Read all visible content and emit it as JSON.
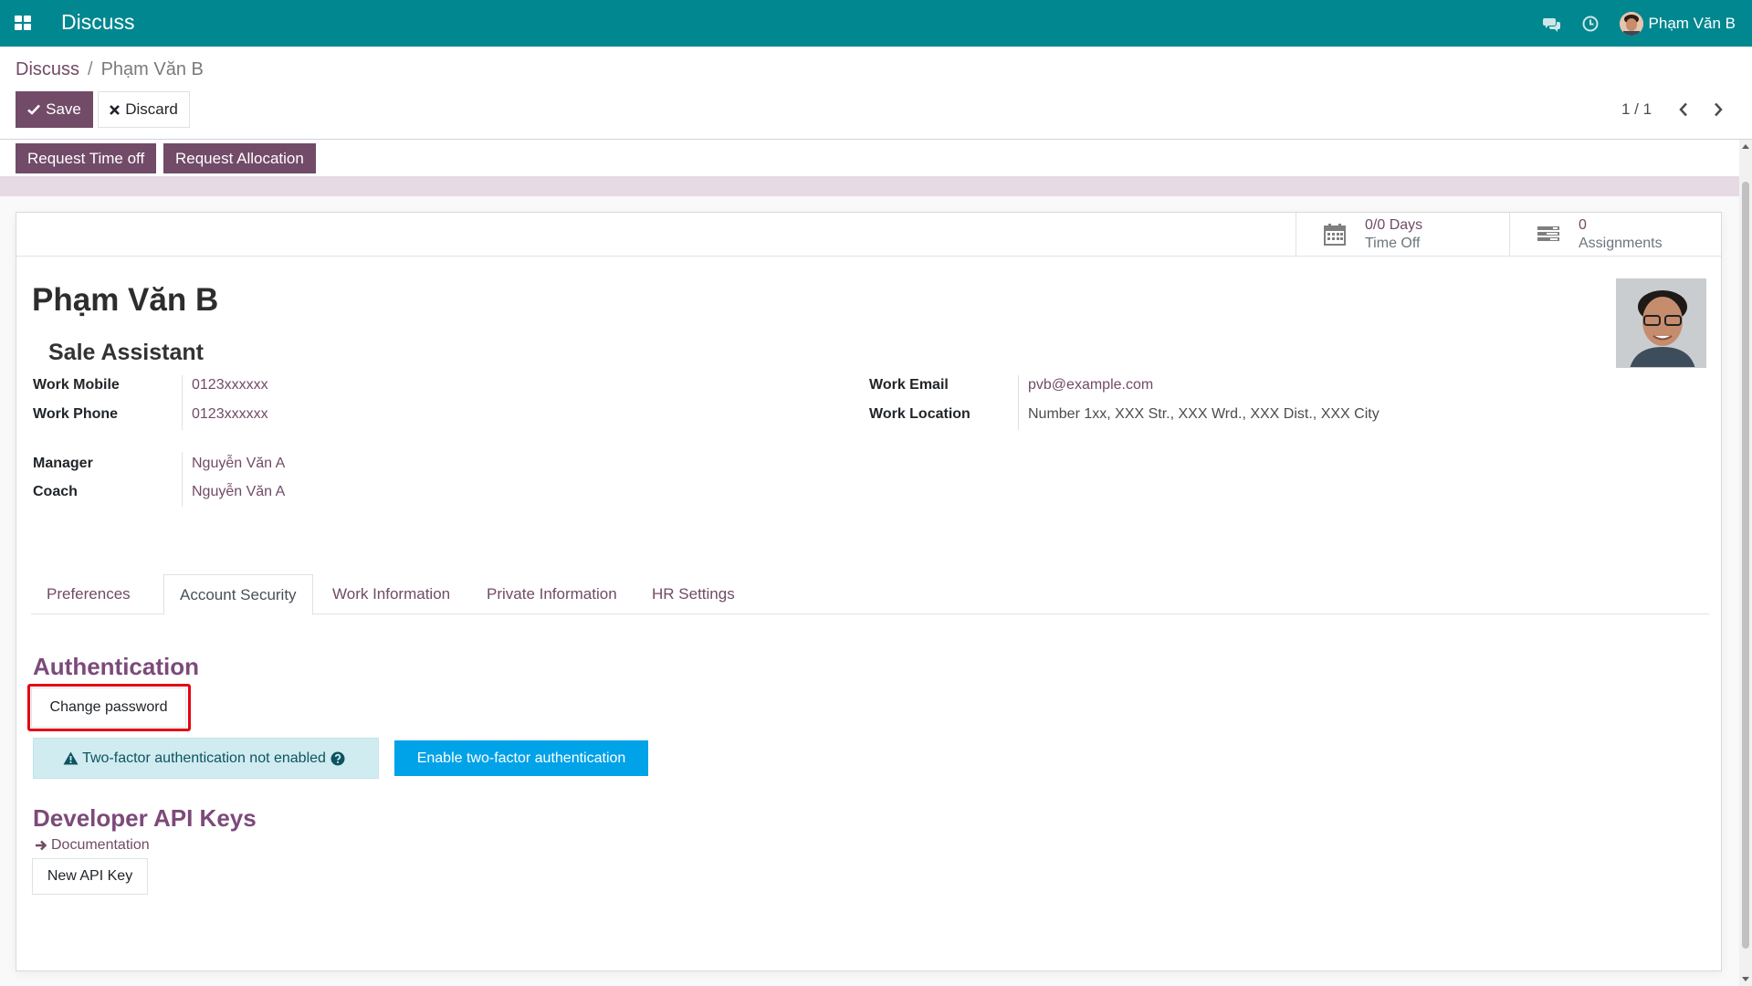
{
  "navbar": {
    "app_name": "Discuss",
    "user_name": "Phạm Văn B"
  },
  "breadcrumb": {
    "parent": "Discuss",
    "separator": "/",
    "current": "Phạm Văn B"
  },
  "actions": {
    "save_label": "Save",
    "discard_label": "Discard"
  },
  "pager": {
    "value": "1 / 1"
  },
  "header_buttons": {
    "request_time_off": "Request Time off",
    "request_allocation": "Request Allocation"
  },
  "smart_buttons": {
    "time_off_value": "0/0 Days",
    "time_off_label": "Time Off",
    "assignments_value": "0",
    "assignments_label": "Assignments"
  },
  "employee": {
    "name": "Phạm Văn B",
    "job_title": "Sale Assistant"
  },
  "fields": {
    "work_mobile_label": "Work Mobile",
    "work_mobile": "0123xxxxxx",
    "work_phone_label": "Work Phone",
    "work_phone": "0123xxxxxx",
    "manager_label": "Manager",
    "manager": "Nguyễn Văn A",
    "coach_label": "Coach",
    "coach": "Nguyễn Văn A",
    "work_email_label": "Work Email",
    "work_email": "pvb@example.com",
    "work_location_label": "Work Location",
    "work_location": "Number 1xx, XXX Str., XXX Wrd., XXX Dist., XXX City"
  },
  "tabs": [
    {
      "label": "Preferences",
      "active": false
    },
    {
      "label": "Account Security",
      "active": true
    },
    {
      "label": "Work Information",
      "active": false
    },
    {
      "label": "Private Information",
      "active": false
    },
    {
      "label": "HR Settings",
      "active": false
    }
  ],
  "security": {
    "authentication_title": "Authentication",
    "change_password_label": "Change password",
    "two_factor_status": "Two-factor authentication not enabled",
    "enable_two_factor_label": "Enable two-factor authentication",
    "api_keys_title": "Developer API Keys",
    "documentation_label": "Documentation",
    "new_api_key_label": "New API Key"
  },
  "colors": {
    "navbar": "#00878f",
    "primary": "#714b67",
    "info_button": "#00a2e8",
    "highlight": "#e30613"
  }
}
